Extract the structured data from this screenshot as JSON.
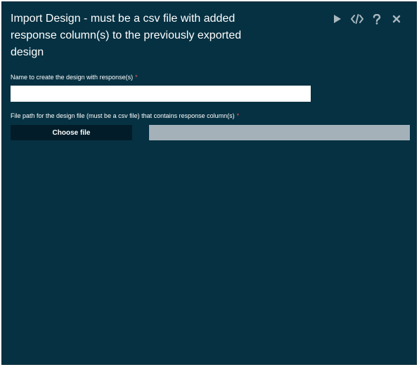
{
  "dialog": {
    "title": "Import Design - must be a csv file with added response column(s) to the previously exported design"
  },
  "toolbar": {
    "icons": [
      "play-icon",
      "code-icon",
      "help-icon",
      "close-icon"
    ]
  },
  "form": {
    "name_field": {
      "label": "Name to create the design with response(s)",
      "required_mark": "*",
      "value": "",
      "placeholder": ""
    },
    "file_field": {
      "label": "File path for the design file (must be a csv file) that contains response column(s)",
      "required_mark": "*",
      "button_label": "Choose file",
      "path_value": ""
    }
  },
  "colors": {
    "panel_background": "#063142",
    "button_background": "#021d29",
    "file_display_background": "#a5b1b9",
    "required_mark": "#e05b5b",
    "icon_color": "#a9b7bf"
  }
}
